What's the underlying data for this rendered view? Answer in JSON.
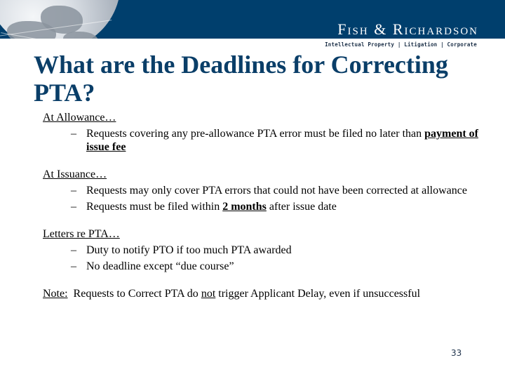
{
  "header": {
    "firm_name": "Fish & Richardson",
    "tagline": "Intellectual Property  |  Litigation  |  Corporate",
    "band_color": "#003f6d",
    "logo_icon": "globe-icon"
  },
  "slide": {
    "title": "What are the Deadlines for Correcting PTA?",
    "title_color": "#0a3e68",
    "sections": [
      {
        "heading": "At Allowance…",
        "bullets": [
          {
            "parts": [
              {
                "text": "Requests covering any pre-allowance PTA error must be filed no later than ",
                "style": "normal"
              },
              {
                "text": "payment of issue fee",
                "style": "bold-underline"
              }
            ]
          }
        ]
      },
      {
        "heading": "At Issuance…",
        "bullets": [
          {
            "parts": [
              {
                "text": "Requests may only cover PTA errors that could not have been corrected at allowance",
                "style": "normal"
              }
            ]
          },
          {
            "parts": [
              {
                "text": "Requests must be filed within ",
                "style": "normal"
              },
              {
                "text": "2 months",
                "style": "bold-underline"
              },
              {
                "text": " after issue date",
                "style": "normal"
              }
            ]
          }
        ]
      },
      {
        "heading": "Letters re PTA…",
        "bullets": [
          {
            "parts": [
              {
                "text": "Duty to notify PTO if too much PTA awarded",
                "style": "normal"
              }
            ]
          },
          {
            "parts": [
              {
                "text": "No deadline except “due course”",
                "style": "normal"
              }
            ]
          }
        ]
      }
    ],
    "note": {
      "label": "Note:",
      "text_before": "  Requests to Correct PTA do ",
      "emphasis": "not",
      "text_after": " trigger Applicant Delay, even if unsuccessful"
    },
    "bullet_marker": "–",
    "page_number": "33"
  }
}
